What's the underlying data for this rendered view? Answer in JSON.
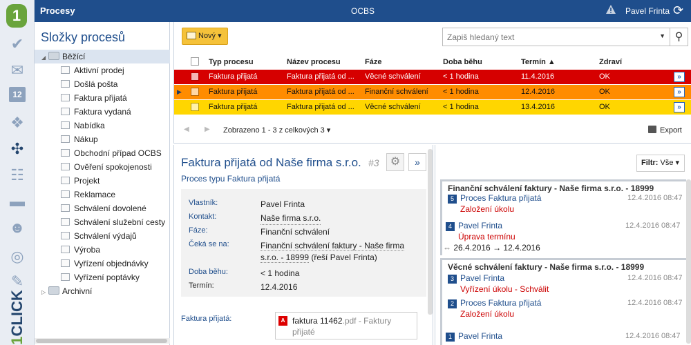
{
  "rail": {
    "logo": "1",
    "items": [
      "check-icon",
      "mail-icon",
      "calendar-icon",
      "puzzle-icon",
      "process-icon",
      "org-icon",
      "folder-icon",
      "people-icon",
      "help-icon",
      "tools-icon"
    ],
    "calendar_day": "12",
    "brand": "CLICK",
    "brand_prefix": "1"
  },
  "topbar": {
    "title": "Procesy",
    "center": "OCBS",
    "user": "Pavel Frinta"
  },
  "folders": {
    "title": "Složky procesů",
    "root_open": "Běžící",
    "children": [
      "Aktivní prodej",
      "Došlá pošta",
      "Faktura přijatá",
      "Faktura vydaná",
      "Nabídka",
      "Nákup",
      "Obchodní případ OCBS",
      "Ověření spokojenosti",
      "Projekt",
      "Reklamace",
      "Schválení dovolené",
      "Schválení služební cesty",
      "Schválení výdajů",
      "Výroba",
      "Vyřízení objednávky",
      "Vyřízení poptávky"
    ],
    "root_closed": "Archivní"
  },
  "toolbar": {
    "new_label": "Nový ▾",
    "search_placeholder": "Zapiš hledaný text"
  },
  "grid": {
    "headers": [
      "Typ procesu",
      "Název procesu",
      "Fáze",
      "Doba běhu",
      "Termín ▲",
      "Zdraví"
    ],
    "rows": [
      {
        "type": "Faktura přijatá",
        "name": "Faktura přijatá od ...",
        "phase": "Věcné schválení",
        "duration": "< 1 hodina",
        "term": "11.4.2016",
        "health": "OK"
      },
      {
        "type": "Faktura přijatá",
        "name": "Faktura přijatá od ...",
        "phase": "Finanční schválení",
        "duration": "< 1 hodina",
        "term": "12.4.2016",
        "health": "OK"
      },
      {
        "type": "Faktura přijatá",
        "name": "Faktura přijatá od ...",
        "phase": "Věcné schválení",
        "duration": "< 1 hodina",
        "term": "13.4.2016",
        "health": "OK"
      }
    ],
    "row_colors": [
      "#d60000",
      "#ff8c00",
      "#ffd600"
    ],
    "pager_label": "Zobrazeno 1 - 3 z celkových 3 ▾",
    "export_label": "Export"
  },
  "detail": {
    "title": "Faktura přijatá od Naše firma s.r.o.",
    "number": "#3",
    "subtitle": "Proces typu Faktura přijatá",
    "props": [
      {
        "k": "Vlastník:",
        "v": "Pavel Frinta"
      },
      {
        "k": "Kontakt:",
        "v": "Naše firma s.r.o."
      },
      {
        "k": "Fáze:",
        "v": "Finanční schválení"
      },
      {
        "k": "Čeká se na:",
        "v": "Finanční schválení faktury - Naše firma s.r.o. - 18999",
        "v2": " (řeší Pavel Frinta)"
      },
      {
        "k": "Doba běhu:",
        "v": "< 1 hodina"
      },
      {
        "k": "Termín:",
        "v": "12.4.2016"
      }
    ],
    "attach_label": "Faktura přijatá:",
    "attach_file": "faktura 11462",
    "attach_ext": ".pdf - Faktury přijaté",
    "pdf_badge": "A"
  },
  "history": {
    "filter_prefix": "Filtr:",
    "filter_value": "Vše ▾",
    "groups": [
      {
        "title": "Finanční schválení faktury - Naše firma s.r.o. - 18999"
      },
      {
        "title": "Věcné schválení faktury - Naše firma s.r.o. - 18999"
      }
    ],
    "items": [
      {
        "n": "5",
        "who": "Proces Faktura přijatá",
        "when": "12.4.2016 08:47",
        "what": "Založení úkolu"
      },
      {
        "n": "4",
        "who": "Pavel Frinta",
        "when": "12.4.2016 08:47",
        "what": "Úprava termínu",
        "dates": "26.4.2016 → 12.4.2016"
      },
      {
        "n": "3",
        "who": "Pavel Frinta",
        "when": "12.4.2016 08:47",
        "what": "Vyřízení úkolu - Schválit"
      },
      {
        "n": "2",
        "who": "Proces Faktura přijatá",
        "when": "12.4.2016 08:47",
        "what": "Založení úkolu"
      },
      {
        "n": "1",
        "who": "Pavel Frinta",
        "when": "12.4.2016 08:47"
      }
    ]
  }
}
